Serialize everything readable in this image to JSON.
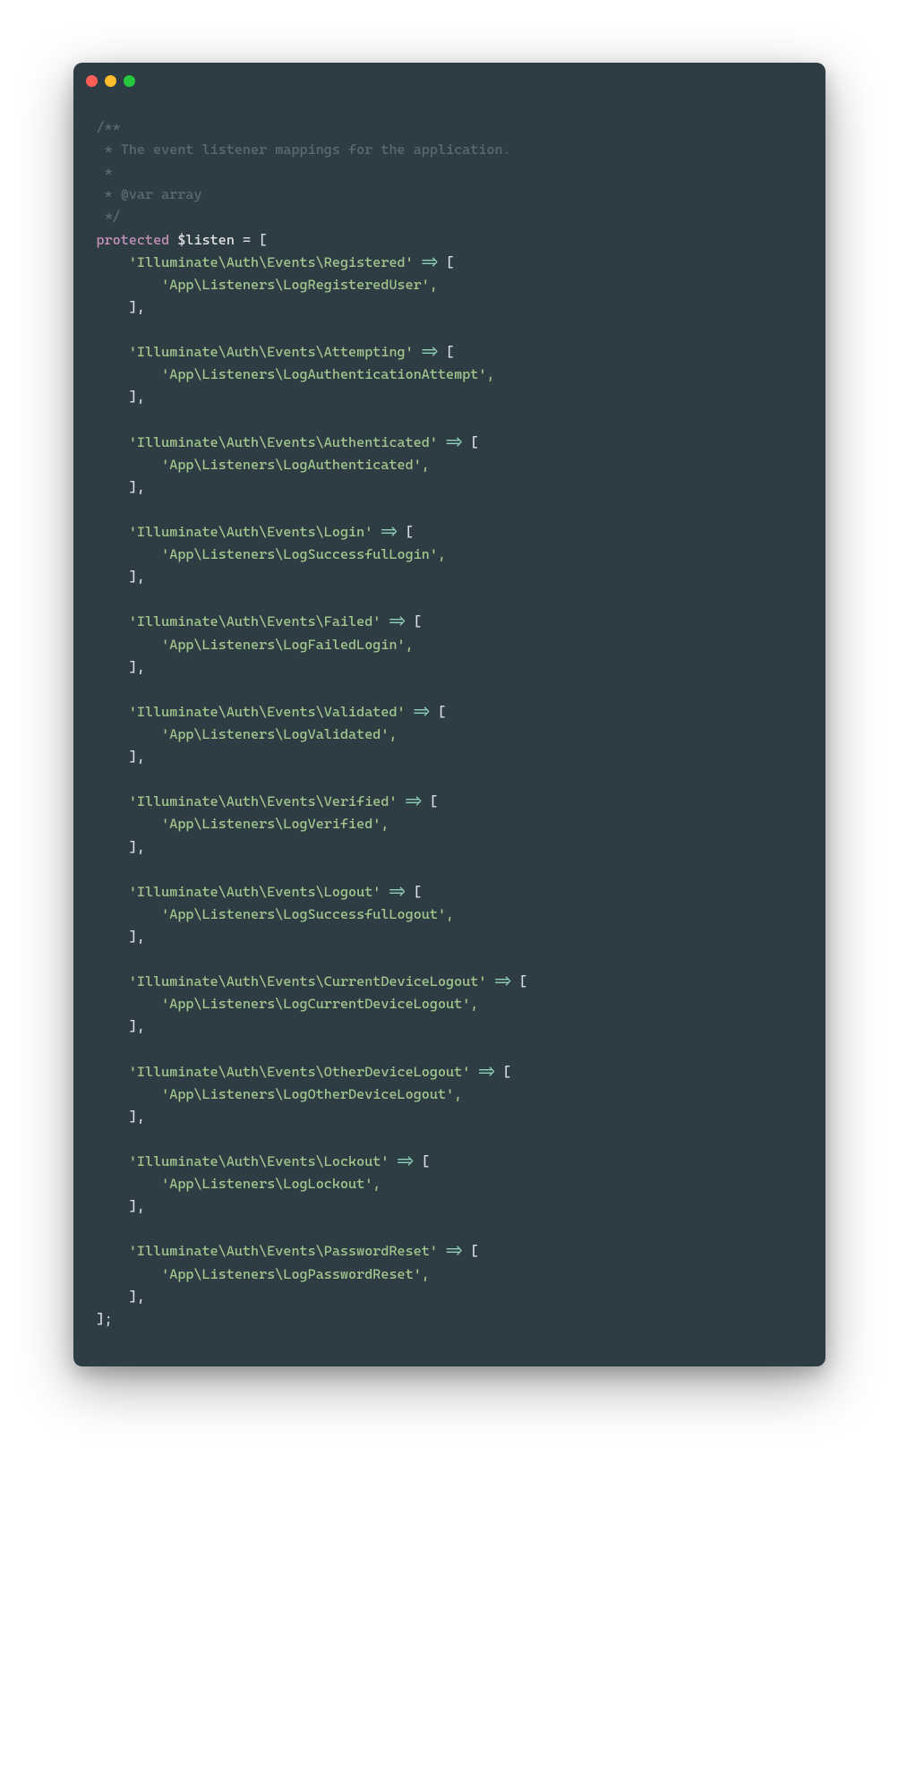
{
  "comment": {
    "open": "/**",
    "l1": " * The event listener mappings for the application.",
    "l2": " *",
    "l3": " * @var array",
    "close": " */"
  },
  "decl": {
    "keyword": "protected",
    "var": "$listen",
    "eq": " = [",
    "close": "];"
  },
  "arrow": "=>",
  "open_bracket": "[",
  "close_sub": "],",
  "entries": [
    {
      "event": "'Illuminate\\Auth\\Events\\Registered'",
      "listener": "'App\\Listeners\\LogRegisteredUser',"
    },
    {
      "event": "'Illuminate\\Auth\\Events\\Attempting'",
      "listener": "'App\\Listeners\\LogAuthenticationAttempt',"
    },
    {
      "event": "'Illuminate\\Auth\\Events\\Authenticated'",
      "listener": "'App\\Listeners\\LogAuthenticated',"
    },
    {
      "event": "'Illuminate\\Auth\\Events\\Login'",
      "listener": "'App\\Listeners\\LogSuccessfulLogin',"
    },
    {
      "event": "'Illuminate\\Auth\\Events\\Failed'",
      "listener": "'App\\Listeners\\LogFailedLogin',"
    },
    {
      "event": "'Illuminate\\Auth\\Events\\Validated'",
      "listener": "'App\\Listeners\\LogValidated',"
    },
    {
      "event": "'Illuminate\\Auth\\Events\\Verified'",
      "listener": "'App\\Listeners\\LogVerified',"
    },
    {
      "event": "'Illuminate\\Auth\\Events\\Logout'",
      "listener": "'App\\Listeners\\LogSuccessfulLogout',"
    },
    {
      "event": "'Illuminate\\Auth\\Events\\CurrentDeviceLogout'",
      "listener": "'App\\Listeners\\LogCurrentDeviceLogout',"
    },
    {
      "event": "'Illuminate\\Auth\\Events\\OtherDeviceLogout'",
      "listener": "'App\\Listeners\\LogOtherDeviceLogout',"
    },
    {
      "event": "'Illuminate\\Auth\\Events\\Lockout'",
      "listener": "'App\\Listeners\\LogLockout',"
    },
    {
      "event": "'Illuminate\\Auth\\Events\\PasswordReset'",
      "listener": "'App\\Listeners\\LogPasswordReset',"
    }
  ]
}
